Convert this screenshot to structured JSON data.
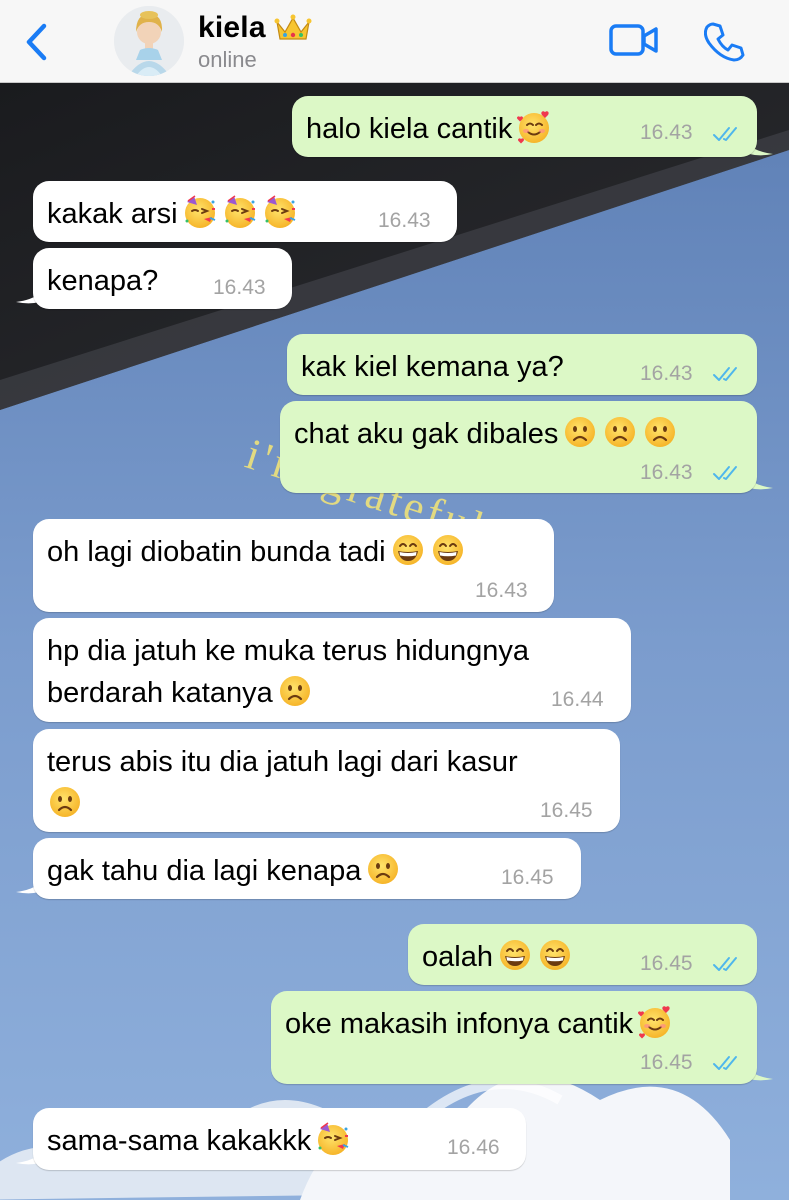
{
  "header": {
    "contact_name": "kiela",
    "status": "online",
    "crown_icon": "crown-emoji",
    "back_icon": "chevron-left-icon",
    "video_icon": "video-camera-icon",
    "call_icon": "phone-icon"
  },
  "colors": {
    "outgoing_bubble": "#dcf8c6",
    "incoming_bubble": "#ffffff",
    "accent": "#1a7cf5",
    "ticks": "#4fb6ec",
    "timestamp": "#a3a3a3"
  },
  "wallpaper_text": "i'm grateful fo",
  "messages": [
    {
      "direction": "out",
      "text": "halo kiela cantik",
      "emoji": [
        "smiling-face-with-hearts"
      ],
      "time": "16.43",
      "read": true
    },
    {
      "direction": "in",
      "text": "kakak arsi",
      "emoji": [
        "partying-face",
        "partying-face",
        "partying-face"
      ],
      "time": "16.43"
    },
    {
      "direction": "in",
      "text": "kenapa?",
      "emoji": [],
      "time": "16.43"
    },
    {
      "direction": "out",
      "text": "kak kiel kemana ya?",
      "emoji": [],
      "time": "16.43",
      "read": true
    },
    {
      "direction": "out",
      "text": "chat aku gak dibales",
      "emoji": [
        "frowning-face",
        "frowning-face",
        "frowning-face"
      ],
      "time": "16.43",
      "read": true
    },
    {
      "direction": "in",
      "text": "oh lagi diobatin bunda tadi",
      "emoji": [
        "grinning-face",
        "grinning-face"
      ],
      "time": "16.43"
    },
    {
      "direction": "in",
      "line1": "hp dia jatuh ke muka terus hidungnya",
      "line2": "berdarah katanya",
      "emoji": [
        "frowning-face"
      ],
      "time": "16.44"
    },
    {
      "direction": "in",
      "line1": "terus abis itu dia jatuh lagi dari kasur",
      "line2": "",
      "emoji": [
        "frowning-face"
      ],
      "time": "16.45"
    },
    {
      "direction": "in",
      "text": "gak tahu dia lagi kenapa",
      "emoji": [
        "frowning-face"
      ],
      "time": "16.45"
    },
    {
      "direction": "out",
      "text": "oalah",
      "emoji": [
        "grinning-face",
        "grinning-face"
      ],
      "time": "16.45",
      "read": true
    },
    {
      "direction": "out",
      "text": "oke makasih infonya cantik",
      "emoji": [
        "smiling-face-with-hearts"
      ],
      "time": "16.45",
      "read": true
    },
    {
      "direction": "in",
      "text": "sama-sama kakakkk",
      "emoji": [
        "partying-face"
      ],
      "time": "16.46"
    }
  ]
}
